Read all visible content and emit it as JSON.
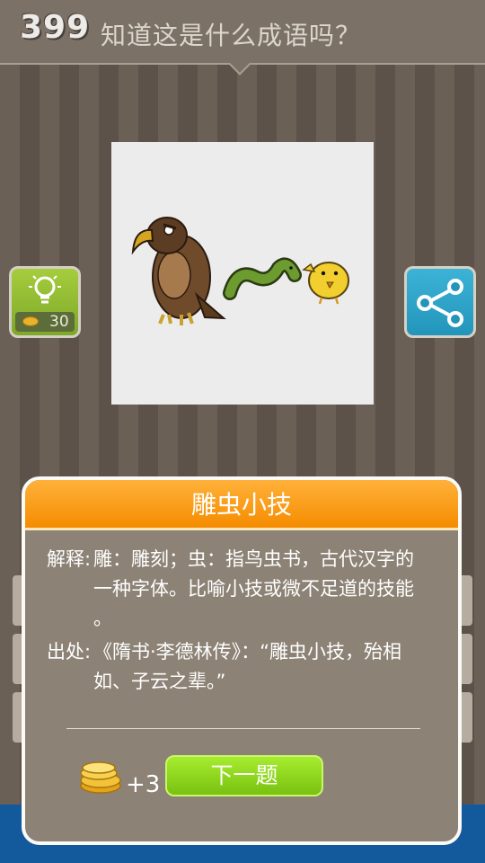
{
  "header": {
    "level": "399",
    "question": "知道这是什么成语吗？"
  },
  "hint": {
    "icon": "lightbulb-icon",
    "cost": "30"
  },
  "share": {
    "icon": "share-icon"
  },
  "puzzle": {
    "image_items": [
      "eagle",
      "worm",
      "chick"
    ]
  },
  "dialog": {
    "title": "雕虫小技",
    "explanation_label": "解释:",
    "explanation_line1": "雕：雕刻；虫：指鸟虫书，古代汉字的",
    "explanation_line2": "一种字体。比喻小技或微不足道的技能",
    "explanation_line3": "。",
    "source_label": "出处:",
    "source_line1": "《隋书·李德林传》：“雕虫小技，殆相",
    "source_line2": "如、子云之辈。”",
    "reward": "+3",
    "next_label": "下一题"
  },
  "colors": {
    "accent_orange": "#f58c00",
    "next_green": "#79c211",
    "hint_green": "#7ea82a",
    "share_blue": "#2395bb"
  }
}
